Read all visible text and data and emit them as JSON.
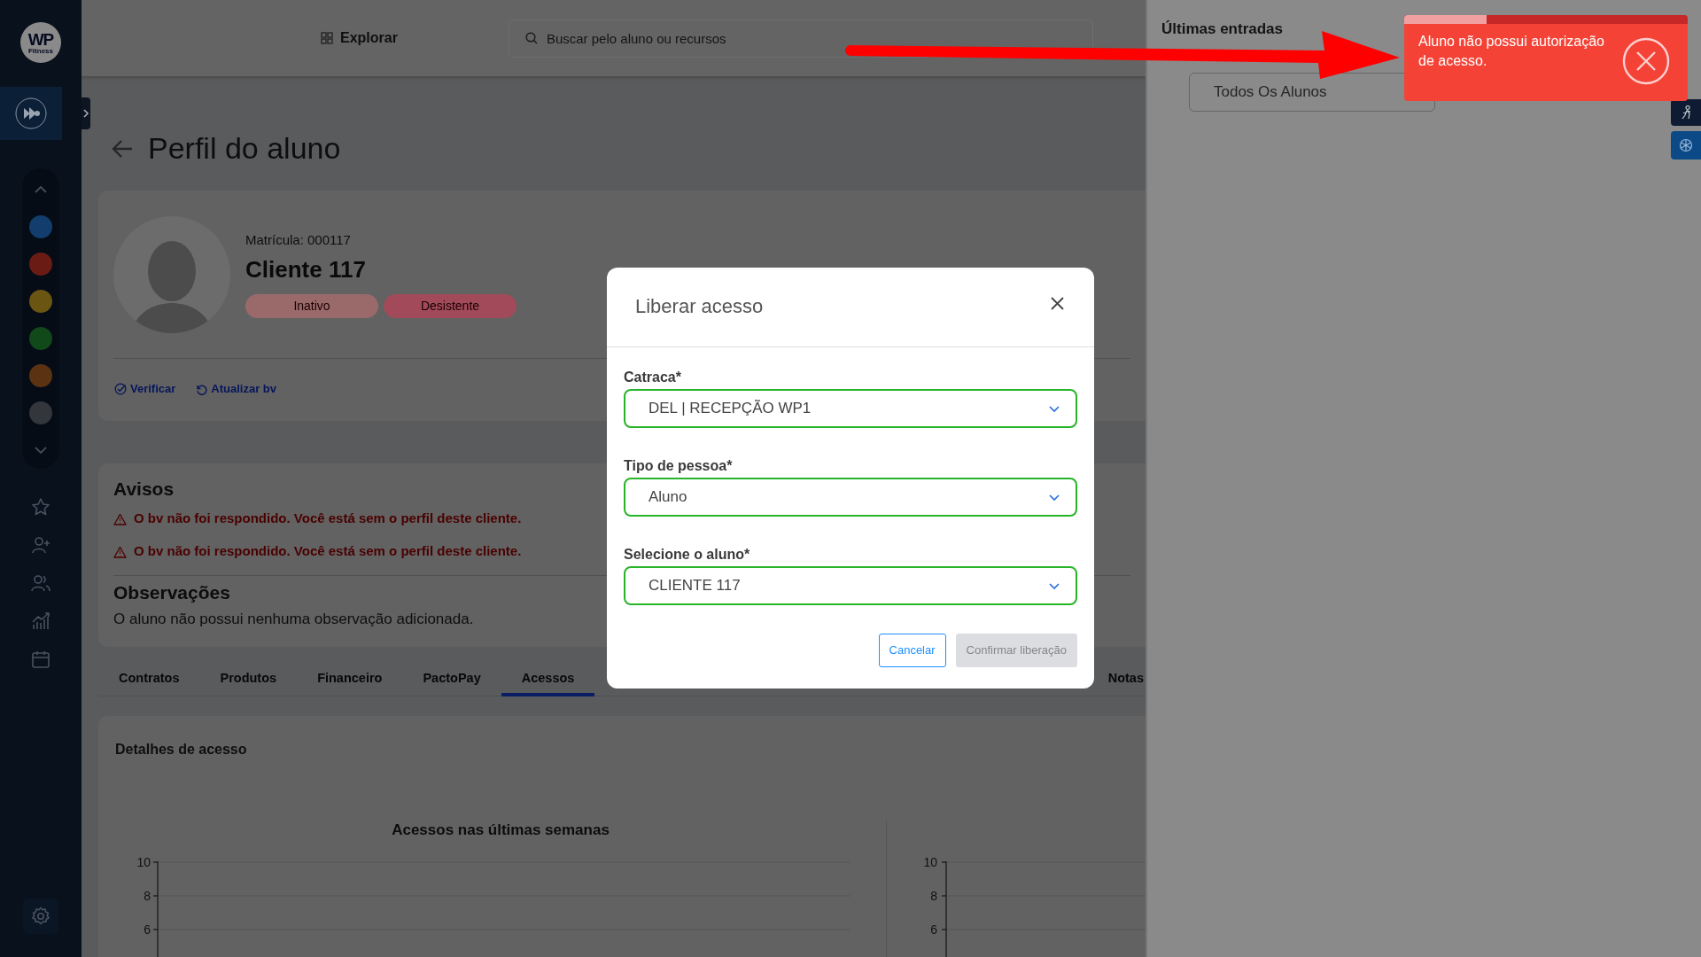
{
  "sidebar": {
    "logo": {
      "title": "WP",
      "subtitle": "Fitness"
    },
    "modules": [
      {
        "color": "#123d6c"
      },
      {
        "color": "#6a1c14"
      },
      {
        "color": "#6a5512"
      },
      {
        "color": "#11491b"
      },
      {
        "color": "#5c3312"
      },
      {
        "color": "#33363b"
      }
    ]
  },
  "topbar": {
    "explore": "Explorar",
    "search": {
      "placeholder": "Buscar pelo aluno ou recursos"
    }
  },
  "page": {
    "title": "Perfil do aluno"
  },
  "profile": {
    "registration": "Matrícula: 000117",
    "name": "Cliente 117",
    "badges": [
      {
        "label": "Inativo",
        "color": "#9a6a6a"
      },
      {
        "label": "Desistente",
        "color": "#a24a5a"
      }
    ],
    "actions": [
      {
        "label": "Verificar",
        "kind": "verify"
      },
      {
        "label": "Atualizar bv",
        "kind": "refresh"
      }
    ]
  },
  "notices": {
    "title": "Avisos",
    "items": [
      "O bv não foi respondido. Você está sem o perfil deste cliente.",
      "O bv não foi respondido. Você está sem o perfil deste cliente."
    ]
  },
  "observations": {
    "title": "Observações",
    "text": "O aluno não possui nenhuma observação adicionada."
  },
  "tabs": [
    {
      "label": "Contratos",
      "selected": false
    },
    {
      "label": "Produtos",
      "selected": false
    },
    {
      "label": "Financeiro",
      "selected": false
    },
    {
      "label": "PactoPay",
      "selected": false
    },
    {
      "label": "Acessos",
      "selected": true
    },
    {
      "label": "Notas",
      "selected": false
    }
  ],
  "access_details": {
    "title": "Detalhes de acesso",
    "charts": [
      {
        "title": "Acessos nas últimas semanas",
        "yticks": [
          "10",
          "8",
          "6"
        ]
      },
      {
        "yticks": [
          "10",
          "8",
          "6"
        ]
      }
    ]
  },
  "recent_entries": {
    "title": "Últimas entradas",
    "filter": {
      "value": "Todos Os Alunos"
    }
  },
  "modal": {
    "title": "Liberar acesso",
    "fields": [
      {
        "label": "Catraca*",
        "value": "DEL | RECEPÇÃO WP1"
      },
      {
        "label": "Tipo de pessoa*",
        "value": "Aluno"
      },
      {
        "label": "Selecione o aluno*",
        "value": "CLIENTE 117"
      }
    ],
    "buttons": [
      {
        "label": "Cancelar",
        "kind": "outline",
        "disabled": false
      },
      {
        "label": "Confirmar liberação",
        "kind": "solid",
        "disabled": true
      }
    ]
  },
  "toast": {
    "message": "Aluno não possui autorização de acesso.",
    "level": 0.29
  }
}
